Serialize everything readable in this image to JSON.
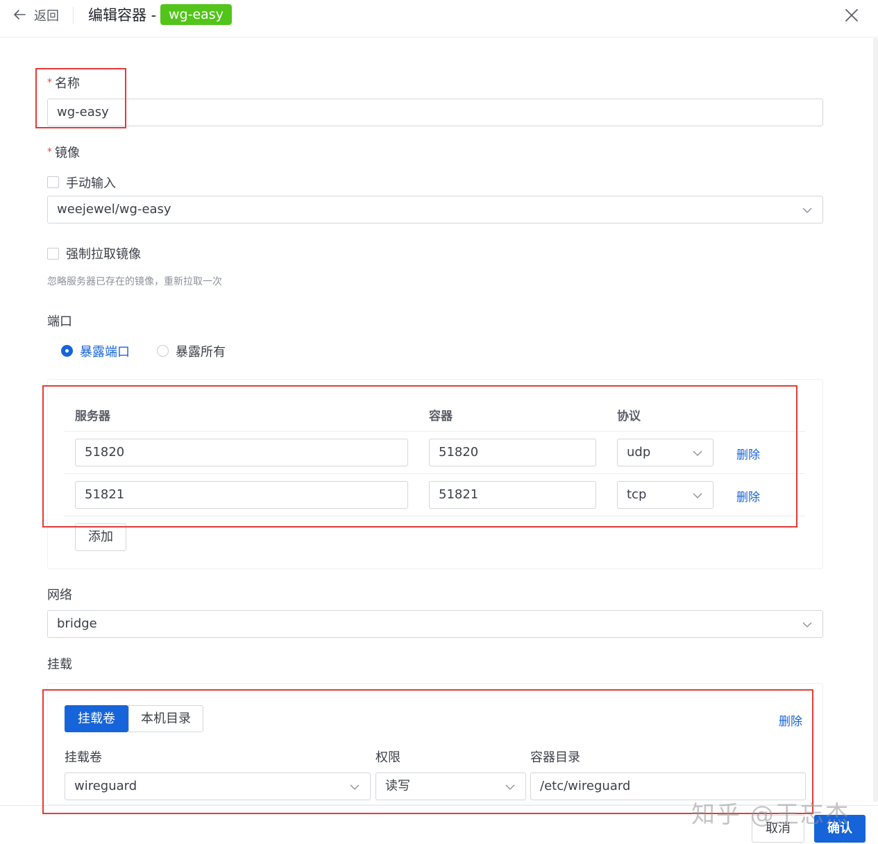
{
  "header": {
    "back_label": "返回",
    "title": "编辑容器 -",
    "container_name_tag": "wg-easy",
    "tag_color": "#52c41a"
  },
  "form": {
    "name": {
      "label": "名称",
      "required_mark": "*",
      "value": "wg-easy"
    },
    "image": {
      "label": "镜像",
      "required_mark": "*",
      "manual_input_label": "手动输入",
      "manual_input_checked": false,
      "value": "weejewel/wg-easy",
      "force_pull_label": "强制拉取镜像",
      "force_pull_checked": false,
      "force_pull_hint": "忽略服务器已存在的镜像，重新拉取一次"
    },
    "ports": {
      "label": "端口",
      "options": [
        {
          "label": "暴露端口",
          "selected": true
        },
        {
          "label": "暴露所有",
          "selected": false
        }
      ],
      "columns": {
        "server": "服务器",
        "container": "容器",
        "protocol": "协议"
      },
      "rows": [
        {
          "server": "51820",
          "container": "51820",
          "protocol": "udp",
          "delete_label": "删除"
        },
        {
          "server": "51821",
          "container": "51821",
          "protocol": "tcp",
          "delete_label": "删除"
        }
      ],
      "add_label": "添加"
    },
    "network": {
      "label": "网络",
      "value": "bridge"
    },
    "mounts": {
      "label": "挂载",
      "tabs": [
        {
          "label": "挂载卷",
          "active": true
        },
        {
          "label": "本机目录",
          "active": false
        }
      ],
      "delete_label": "删除",
      "columns": {
        "volume": "挂载卷",
        "permission": "权限",
        "container_dir": "容器目录"
      },
      "row": {
        "volume": "wireguard",
        "permission": "读写",
        "container_dir": "/etc/wireguard"
      }
    }
  },
  "footer": {
    "cancel_label": "取消",
    "confirm_label": "确认"
  },
  "watermark": "知乎 @王忘杰",
  "colors": {
    "primary": "#1664d9",
    "highlight": "#e53935"
  }
}
